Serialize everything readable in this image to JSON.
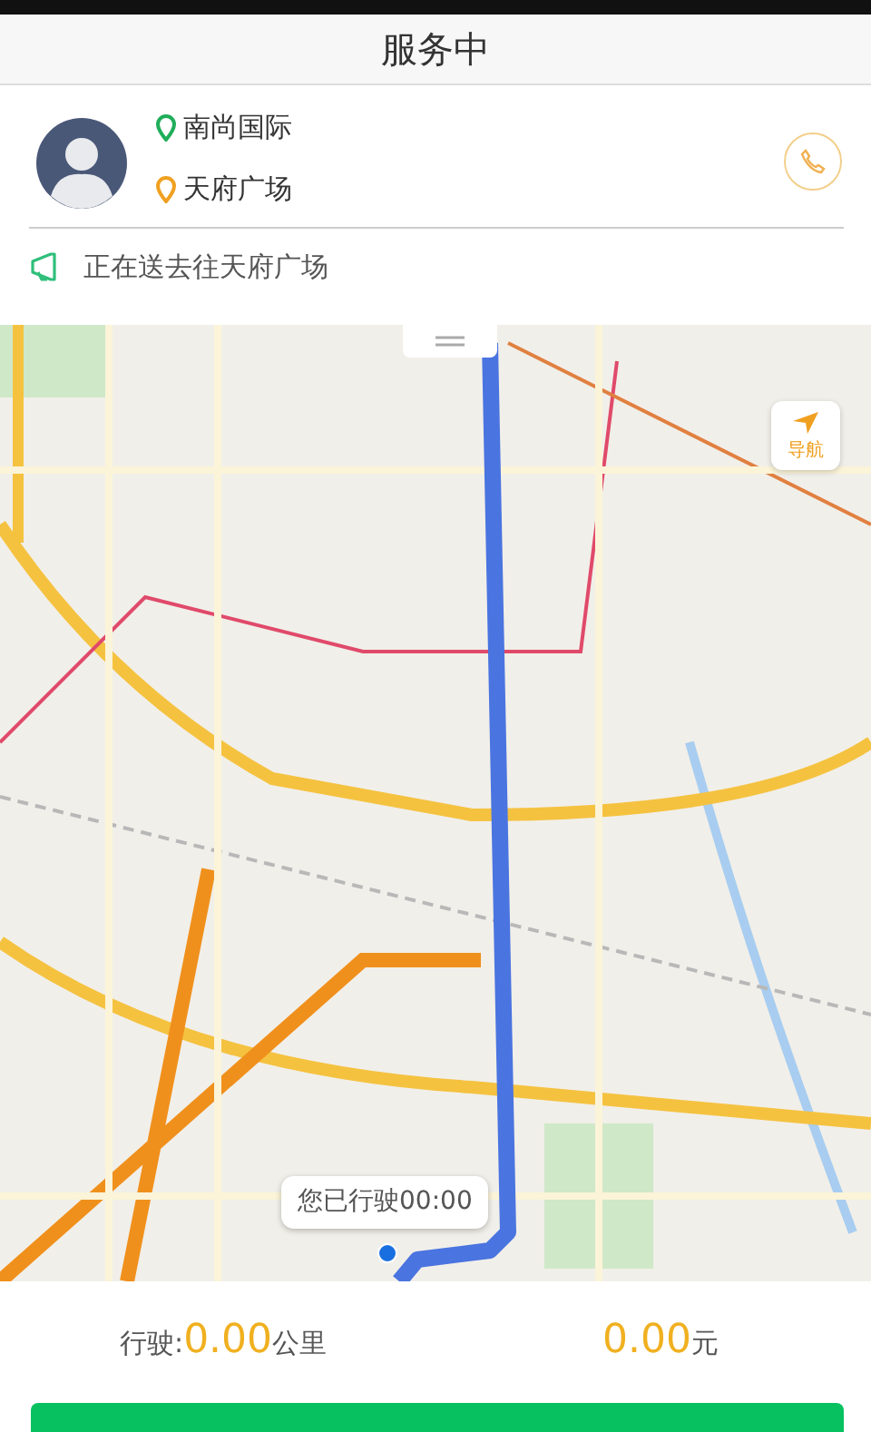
{
  "header": {
    "title": "服务中"
  },
  "trip": {
    "origin": "南尚国际",
    "destination": "天府广场"
  },
  "notice": "正在送去往天府广场",
  "map": {
    "nav_button": "导航",
    "bubble": "您已行驶00:00"
  },
  "stats": {
    "distance_label": "行驶:",
    "distance_value": "0.00",
    "distance_unit": "公里",
    "fare_value": "0.00",
    "fare_unit": "元"
  }
}
